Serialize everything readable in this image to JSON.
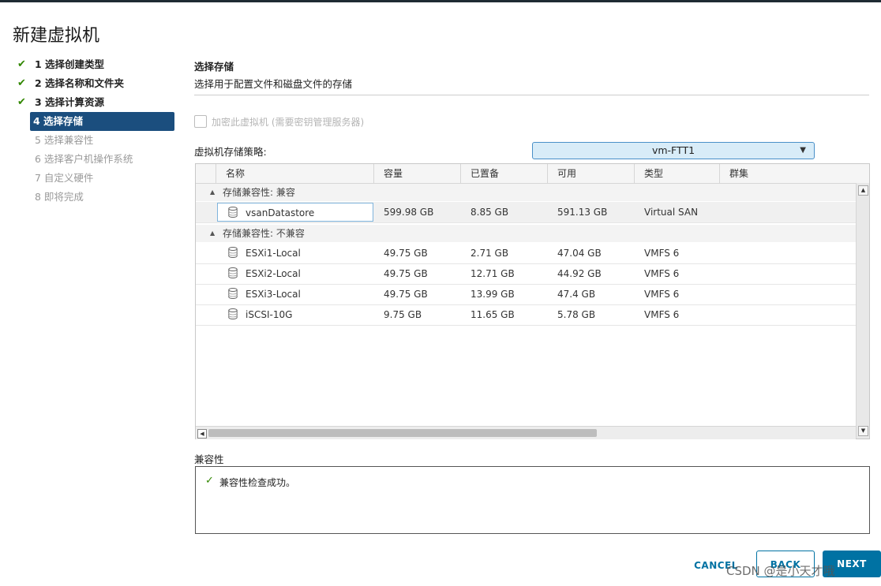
{
  "dialog": {
    "title": "新建虚拟机"
  },
  "steps": [
    {
      "label": "1 选择创建类型",
      "state": "done"
    },
    {
      "label": "2 选择名称和文件夹",
      "state": "done"
    },
    {
      "label": "3 选择计算资源",
      "state": "done"
    },
    {
      "label": "4 选择存储",
      "state": "active"
    },
    {
      "label": "5 选择兼容性",
      "state": "future"
    },
    {
      "label": "6 选择客户机操作系统",
      "state": "future"
    },
    {
      "label": "7 自定义硬件",
      "state": "future"
    },
    {
      "label": "8 即将完成",
      "state": "future"
    }
  ],
  "storage": {
    "section_title": "选择存储",
    "section_subtitle": "选择用于配置文件和磁盘文件的存储",
    "encrypt_label": "加密此虚拟机 (需要密钥管理服务器)",
    "policy_label": "虚拟机存储策略:",
    "policy_value": "vm-FTT1",
    "columns": [
      "名称",
      "容量",
      "已置备",
      "可用",
      "类型",
      "群集"
    ],
    "groups": [
      {
        "label": "存储兼容性: 兼容",
        "rows": [
          {
            "name": "vsanDatastore",
            "capacity": "599.98 GB",
            "provisioned": "8.85 GB",
            "free": "591.13 GB",
            "type": "Virtual SAN",
            "cluster": ""
          }
        ]
      },
      {
        "label": "存储兼容性: 不兼容",
        "rows": [
          {
            "name": "ESXi1-Local",
            "capacity": "49.75 GB",
            "provisioned": "2.71 GB",
            "free": "47.04 GB",
            "type": "VMFS 6",
            "cluster": ""
          },
          {
            "name": "ESXi2-Local",
            "capacity": "49.75 GB",
            "provisioned": "12.71 GB",
            "free": "44.92 GB",
            "type": "VMFS 6",
            "cluster": ""
          },
          {
            "name": "ESXi3-Local",
            "capacity": "49.75 GB",
            "provisioned": "13.99 GB",
            "free": "47.4 GB",
            "type": "VMFS 6",
            "cluster": ""
          },
          {
            "name": "iSCSI-10G",
            "capacity": "9.75 GB",
            "provisioned": "11.65 GB",
            "free": "5.78 GB",
            "type": "VMFS 6",
            "cluster": ""
          }
        ]
      }
    ],
    "compat_label": "兼容性",
    "compat_message": "兼容性检查成功。"
  },
  "footer": {
    "cancel": "CANCEL",
    "back": "BACK",
    "next": "NEXT"
  },
  "watermark": "CSDN @是小天才哦",
  "colors": {
    "accent": "#0072a3",
    "active_step": "#1b4e7e",
    "success": "#318700"
  },
  "icons": {
    "step_done": "checkmark-icon",
    "datastore": "database-icon",
    "dropdown": "chevron-down-icon"
  }
}
